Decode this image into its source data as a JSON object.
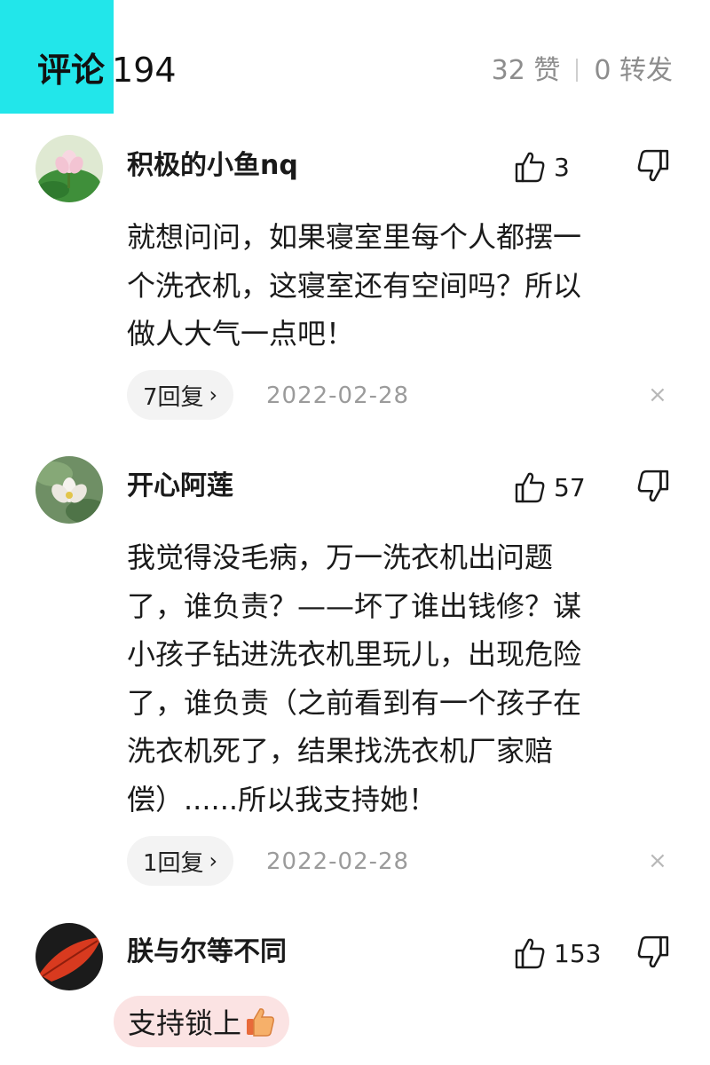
{
  "header": {
    "title": "评论",
    "count": "194",
    "likes": "32 赞",
    "reposts": "0 转发"
  },
  "comments": [
    {
      "username": "积极的小鱼nq",
      "likes": "3",
      "lines": [
        "就想问问，如果寝室里每个人都摆一",
        "个洗衣机，这寝室还有空间吗？所以",
        "做人大气一点吧！"
      ],
      "replies": "7回复",
      "date": "2022-02-28"
    },
    {
      "username": "开心阿莲",
      "likes": "57",
      "lines": [
        "我觉得没毛病，万一洗衣机出问题",
        "了，谁负责？——坏了谁出钱修？谋",
        "小孩子钻进洗衣机里玩儿，出现危险",
        "了，谁负责（之前看到有一个孩子在",
        "洗衣机死了，结果找洗衣机厂家赔",
        "偿）......所以我支持她！"
      ],
      "replies": "1回复",
      "date": "2022-02-28"
    },
    {
      "username": "朕与尔等不同",
      "likes": "153",
      "text": "支持锁上"
    }
  ],
  "icons": {
    "like": "thumbs-up-icon",
    "dislike": "thumbs-down-icon",
    "chevron": "›",
    "close": "×"
  },
  "colors": {
    "title_block": "#22e6ea",
    "muted": "#9b9b9b",
    "chip_bg": "#fbe3e3"
  }
}
